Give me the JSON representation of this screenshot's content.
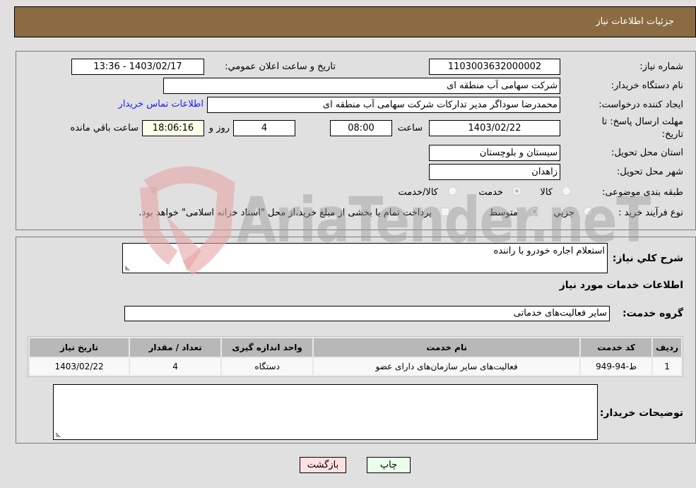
{
  "header": {
    "title": "جزئیات اطلاعات نیاز"
  },
  "form": {
    "need_number_label": "شماره نیاز:",
    "need_number": "1103003632000002",
    "announce_label": "تاریخ و ساعت اعلان عمومي:",
    "announce_value": "1403/02/17 - 13:36",
    "buyer_org_label": "نام دستگاه خریدار:",
    "buyer_org": "شرکت سهامی آب منطقه ای",
    "creator_label": "ایجاد کننده درخواست:",
    "creator": "محمدرضا سوداگر مدیر تدارکات شرکت سهامی آب منطقه ای",
    "contact_link": "اطلاعات تماس خریدار",
    "deadline_label_1": "مهلت ارسال پاسخ: تا",
    "deadline_label_2": "تاریخ:",
    "deadline_date": "1403/02/22",
    "time_label": "ساعت",
    "deadline_time": "08:00",
    "days_value": "4",
    "days_label": "روز و",
    "remaining_time": "18:06:16",
    "remaining_label": "ساعت باقي مانده",
    "province_label": "استان محل تحویل:",
    "province": "سیستان و بلوچستان",
    "city_label": "شهر محل تحویل:",
    "city": "زاهدان",
    "category_label": "طبقه بندی موضوعی:",
    "category_options": [
      {
        "label": "کالا",
        "selected": false
      },
      {
        "label": "خدمت",
        "selected": true
      },
      {
        "label": "کالا/خدمت",
        "selected": false
      }
    ],
    "process_label": "نوع فرآیند خرید :",
    "process_options": [
      {
        "label": "جزیي",
        "selected": false
      },
      {
        "label": "متوسط",
        "selected": true
      }
    ],
    "treasury_note": "پرداخت تمام یا بخشی از مبلغ خرید،از محل \"اسناد خزانه اسلامی\" خواهد بود."
  },
  "details": {
    "description_label": "شرح كلي نياز:",
    "description": "استعلام اجاره خودرو با راننده",
    "services_heading": "اطلاعات خدمات مورد نیاز",
    "service_group_label": "گروه خدمت:",
    "service_group": "سایر فعالیت‌های خدماتی",
    "table": {
      "headers": [
        "ردیف",
        "کد خدمت",
        "نام خدمت",
        "واحد اندازه گیری",
        "تعداد / مقدار",
        "تاریخ نیاز"
      ],
      "rows": [
        [
          "1",
          "ط-94-949",
          "فعالیت‌های سایر سازمان‌های دارای عضو",
          "دستگاه",
          "4",
          "1403/02/22"
        ]
      ]
    },
    "buyer_notes_label": "توضیحات خریدار:",
    "buyer_notes": ""
  },
  "buttons": {
    "print": "چاپ",
    "back": "بازگشت"
  },
  "watermark": {
    "text": "AriaTender.neT"
  },
  "colors": {
    "header_bg": "#8b6b42",
    "print_bg": "#eaffea",
    "back_bg": "#ffe0e0",
    "link": "#1a1aff"
  }
}
